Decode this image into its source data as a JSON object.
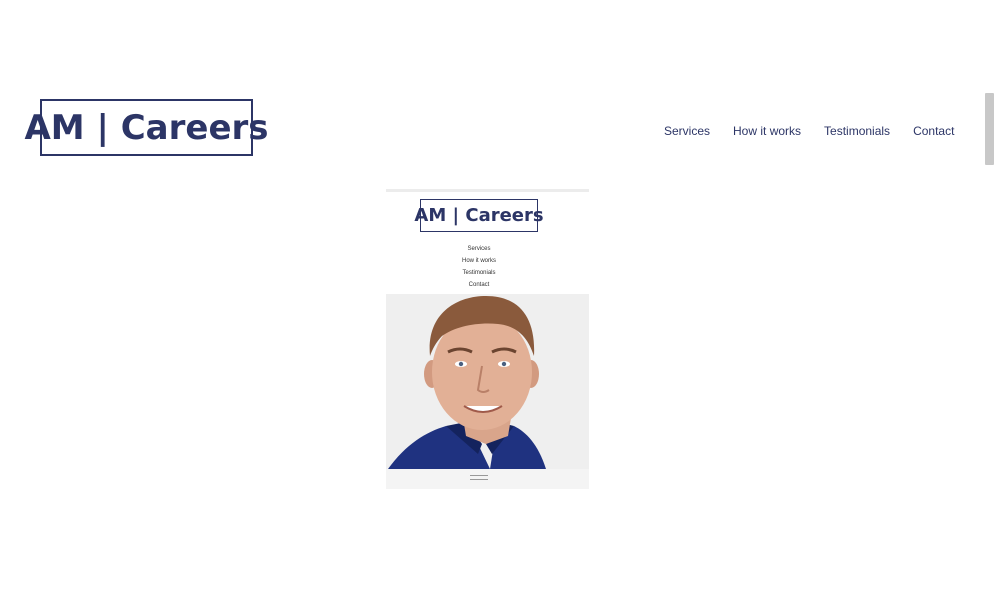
{
  "header": {
    "logo_text": "AM | Careers",
    "nav": [
      "Services",
      "How it works",
      "Testimonials",
      "Contact"
    ]
  },
  "preview": {
    "logo_text": "AM | Careers",
    "nav": [
      "Services",
      "How it works",
      "Testimonials",
      "Contact"
    ]
  },
  "colors": {
    "brand": "#2c3566",
    "background": "#ffffff",
    "photo_bg": "#efefef",
    "shirt": "#1f3280"
  }
}
